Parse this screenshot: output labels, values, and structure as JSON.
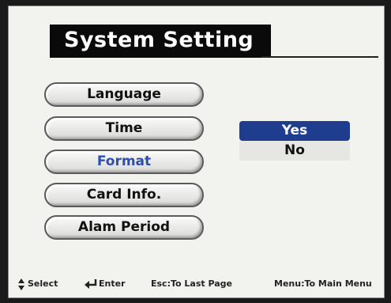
{
  "title": "System Setting",
  "menu": {
    "items": [
      {
        "label": "Language"
      },
      {
        "label": "Time"
      },
      {
        "label": "Format"
      },
      {
        "label": "Card Info."
      },
      {
        "label": "Alam Period"
      }
    ],
    "selected_label": "Format"
  },
  "options": {
    "yes": "Yes",
    "no": "No",
    "highlighted": "Yes"
  },
  "footer": {
    "select_label": "Select",
    "enter_label": "Enter",
    "esc_label": "Esc:To Last Page",
    "menu_label": "Menu:To Main Menu",
    "updown_icon": "up-down-arrow-icon",
    "enter_icon": "enter-arrow-icon"
  },
  "colors": {
    "highlight": "#1f3d8f",
    "selected_text": "#2f4fb0",
    "title_bg": "#0a0a0a"
  }
}
